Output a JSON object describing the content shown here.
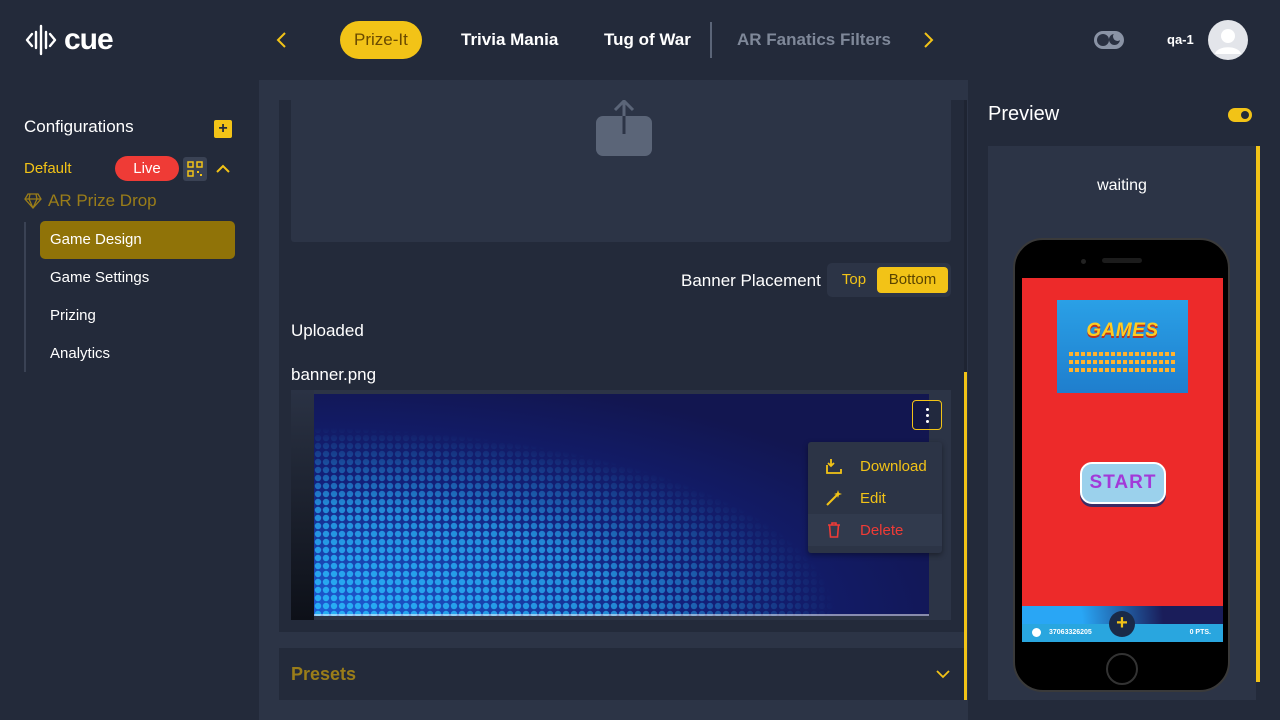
{
  "app": {
    "logo_text": "cue"
  },
  "header": {
    "tabs": [
      {
        "label": "Prize-It",
        "active": true
      },
      {
        "label": "Trivia Mania"
      },
      {
        "label": "Tug of War"
      },
      {
        "label": "AR Fanatics Filters",
        "dim": true
      }
    ],
    "username": "qa-1"
  },
  "sidebar": {
    "title": "Configurations",
    "add_label": "+",
    "config_name": "Default",
    "status": "Live",
    "experience": "AR Prize Drop",
    "items": [
      {
        "label": "Game Design",
        "active": true
      },
      {
        "label": "Game Settings"
      },
      {
        "label": "Prizing"
      },
      {
        "label": "Analytics"
      }
    ]
  },
  "editor": {
    "banner_placement_label": "Banner Placement",
    "placement_options": [
      "Top",
      "Bottom"
    ],
    "placement_selected": "Bottom",
    "uploaded_label": "Uploaded",
    "file_name": "banner.png",
    "file_menu": [
      "Download",
      "Edit",
      "Delete"
    ],
    "presets_label": "Presets"
  },
  "preview": {
    "title": "Preview",
    "status": "waiting",
    "game_title": "GAMES",
    "start_label": "START",
    "player_code": "37063326205",
    "points": "0 PTS.",
    "plus_label": "+"
  },
  "colors": {
    "accent": "#f2c317",
    "live": "#ef3b36",
    "background": "#232a3a",
    "panel": "#2c3446"
  }
}
